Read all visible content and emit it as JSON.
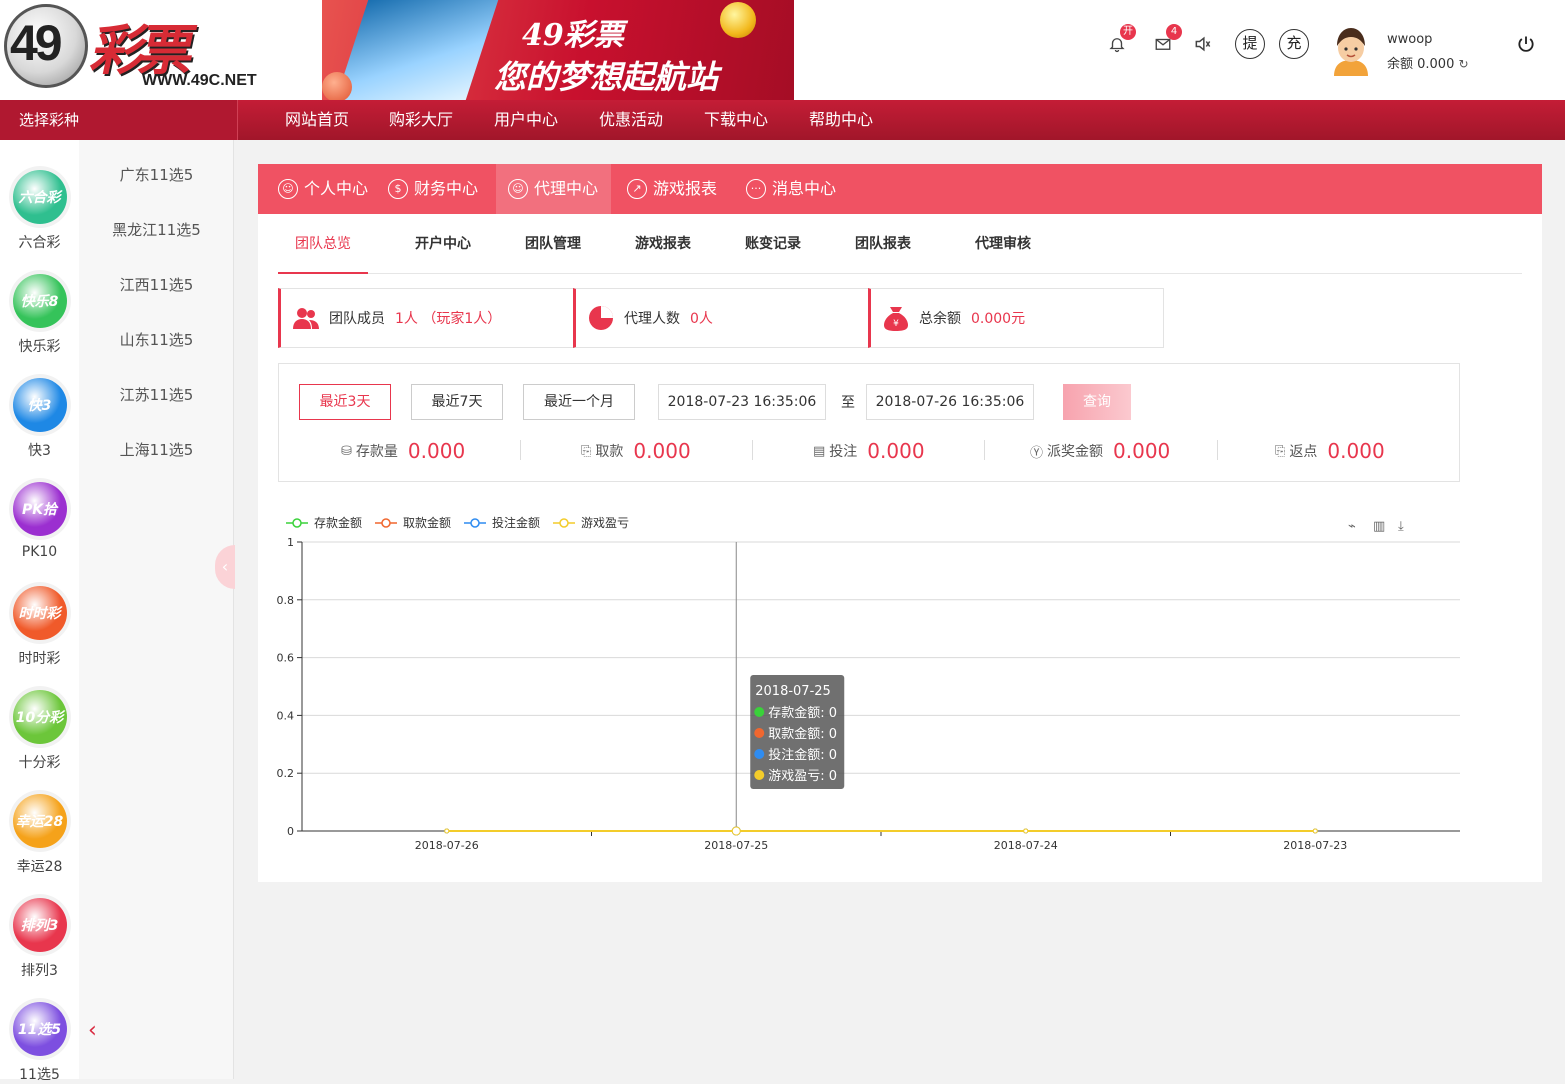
{
  "header": {
    "logo_num": "49",
    "logo_brand": "彩票",
    "logo_url": "WWW.49C.NET",
    "banner_line1": "49彩票",
    "banner_line2": "您的梦想起航站",
    "bell_badge": "开",
    "mail_badge": "4",
    "withdraw_label": "提",
    "deposit_label": "充",
    "username": "wwoop",
    "balance": "余额 0.000",
    "icons": [
      "bell-icon",
      "mail-icon",
      "sound-icon",
      "refresh-icon",
      "power-icon"
    ]
  },
  "nav": {
    "select_lottery": "选择彩种",
    "items": [
      "网站首页",
      "购彩大厅",
      "用户中心",
      "优惠活动",
      "下载中心",
      "帮助中心"
    ]
  },
  "sidebar": {
    "lotteries": [
      {
        "label": "六合彩",
        "icon_text": "六合彩",
        "color": "#2fbf8f"
      },
      {
        "label": "快乐彩",
        "icon_text": "快乐8",
        "color": "#35c35a"
      },
      {
        "label": "快3",
        "icon_text": "快3",
        "color": "#1e88e5"
      },
      {
        "label": "PK10",
        "icon_text": "PK拾",
        "color": "#9b2fd0"
      },
      {
        "label": "时时彩",
        "icon_text": "时时彩",
        "color": "#f05a2a"
      },
      {
        "label": "十分彩",
        "icon_text": "10分彩",
        "color": "#6cc63a"
      },
      {
        "label": "幸运28",
        "icon_text": "幸运28",
        "color": "#f5a21a"
      },
      {
        "label": "排列3",
        "icon_text": "排列3",
        "color": "#e8364d"
      },
      {
        "label": "11选5",
        "icon_text": "11选5",
        "color": "#7d4fe0"
      }
    ],
    "sub_items": [
      "广东11选5",
      "黑龙江11选5",
      "江西11选5",
      "山东11选5",
      "江苏11选5",
      "上海11选5"
    ]
  },
  "main": {
    "tabs": [
      "个人中心",
      "财务中心",
      "代理中心",
      "游戏报表",
      "消息中心"
    ],
    "active_tab": "代理中心",
    "subtabs": [
      "团队总览",
      "开户中心",
      "团队管理",
      "游戏报表",
      "账变记录",
      "团队报表",
      "代理审核"
    ],
    "cards": [
      {
        "label": "团队成员",
        "value": "1人 （玩家1人）"
      },
      {
        "label": "代理人数",
        "value": "0人"
      },
      {
        "label": "总余额",
        "value": "0.000元"
      }
    ],
    "query": {
      "buttons": [
        "最近3天",
        "最近7天",
        "最近一个月"
      ],
      "start": "2018-07-23 16:35:06",
      "to": "至",
      "end": "2018-07-26 16:35:06",
      "search": "查询"
    },
    "stats": [
      {
        "label": "存款量",
        "value": "0.000"
      },
      {
        "label": "取款",
        "value": "0.000"
      },
      {
        "label": "投注",
        "value": "0.000"
      },
      {
        "label": "派奖金额",
        "value": "0.000"
      },
      {
        "label": "返点",
        "value": "0.000"
      }
    ]
  },
  "chart_data": {
    "type": "line",
    "categories": [
      "2018-07-26",
      "2018-07-25",
      "2018-07-24",
      "2018-07-23"
    ],
    "series": [
      {
        "name": "存款金额",
        "color": "#3ad23a",
        "values": [
          0,
          0,
          0,
          0
        ]
      },
      {
        "name": "取款金额",
        "color": "#f0672f",
        "values": [
          0,
          0,
          0,
          0
        ]
      },
      {
        "name": "投注金额",
        "color": "#2f8cf0",
        "values": [
          0,
          0,
          0,
          0
        ]
      },
      {
        "name": "游戏盈亏",
        "color": "#f3cc2a",
        "values": [
          0,
          0,
          0,
          0
        ]
      }
    ],
    "ylim": [
      0,
      1
    ],
    "yticks": [
      "0",
      "0.2",
      "0.4",
      "0.6",
      "0.8",
      "1"
    ],
    "grid": true,
    "legend": "top-left",
    "tooltip": {
      "title": "2018-07-25",
      "rows": [
        "存款金额: 0",
        "取款金额: 0",
        "投注金额: 0",
        "游戏盈亏: 0"
      ]
    }
  }
}
